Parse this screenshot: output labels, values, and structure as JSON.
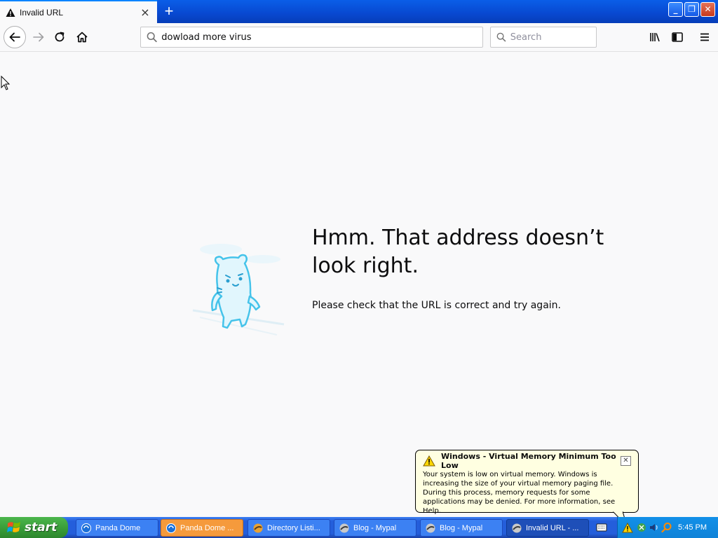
{
  "browser": {
    "tab": {
      "title": "Invalid URL",
      "close": "×"
    },
    "new_tab": "+",
    "window_controls": {
      "minimize": "_",
      "maximize": "❐",
      "close": "✕"
    },
    "address_bar": {
      "value": "dowload more virus"
    },
    "search_bar": {
      "placeholder": "Search"
    }
  },
  "error_page": {
    "title": "Hmm. That address doesn’t look right.",
    "description": "Please check that the URL is correct and try again."
  },
  "balloon": {
    "title": "Windows - Virtual Memory Minimum Too Low",
    "message": "Your system is low on virtual memory. Windows is increasing the size of your virtual memory paging file. During this process, memory requests for some applications may be denied. For more information, see Help.",
    "close": "✕"
  },
  "taskbar": {
    "start_label": "start",
    "tasks": [
      {
        "label": "Panda Dome",
        "icon": "panda-dome-icon",
        "state": "normal"
      },
      {
        "label": "Panda Dome ...",
        "icon": "panda-dome-icon",
        "state": "flashing"
      },
      {
        "label": "Directory Listi...",
        "icon": "firefox-icon",
        "state": "normal"
      },
      {
        "label": "Blog - Mypal",
        "icon": "mypal-icon",
        "state": "normal"
      },
      {
        "label": "Blog - Mypal",
        "icon": "mypal-icon",
        "state": "normal"
      },
      {
        "label": "Invalid URL - ...",
        "icon": "mypal-icon",
        "state": "active"
      }
    ],
    "clock": "5:45 PM"
  }
}
